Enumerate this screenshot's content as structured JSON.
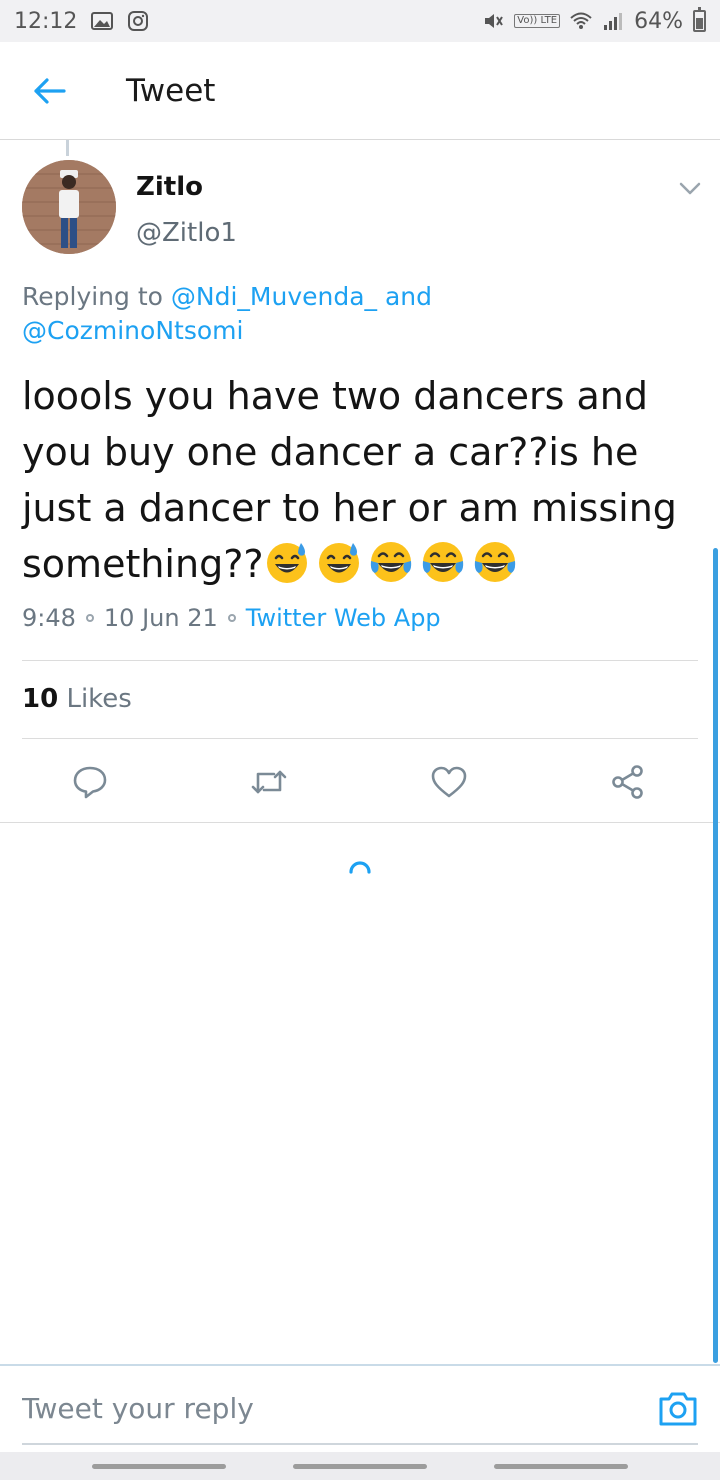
{
  "status_bar": {
    "time": "12:12",
    "battery": "64%",
    "lte_label": "Vo)) LTE"
  },
  "header": {
    "title": "Tweet",
    "back_icon": "arrow-left-icon"
  },
  "tweet": {
    "author_name": "Zitlo",
    "author_handle": "@Zitlo1",
    "replying_prefix": "Replying to ",
    "replying_user1": "@Ndi_Muvenda_",
    "replying_and": " and",
    "replying_user2": "@CozminoNtsomi",
    "text": "loools you have two dancers and you buy one dancer a car??is he just a dancer to her or am missing something??",
    "emojis": [
      "sweat-smile",
      "sweat-smile",
      "tears-of-joy",
      "tears-of-joy",
      "tears-of-joy"
    ],
    "time": "9:48",
    "date": "10 Jun 21",
    "source": "Twitter Web App",
    "likes_count": "10",
    "likes_label": "Likes"
  },
  "actions": {
    "icons": [
      "reply-icon",
      "retweet-icon",
      "like-icon",
      "share-icon"
    ]
  },
  "reply": {
    "placeholder": "Tweet your reply"
  },
  "colors": {
    "accent": "#1da1f2",
    "secondary_text": "#6b7782",
    "divider": "#dcdcdc"
  }
}
